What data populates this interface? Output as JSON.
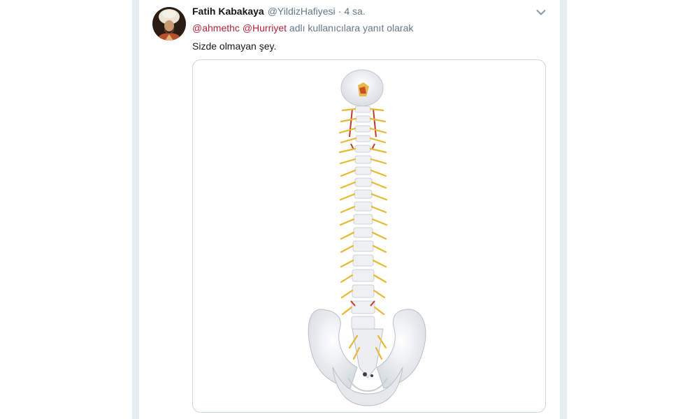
{
  "tweet": {
    "display_name": "Fatih Kabakaya",
    "handle": "@YildizHafiyesi",
    "separator": "·",
    "timestamp": "4 sa.",
    "reply_context": {
      "mentions": [
        "@ahmethc",
        "@Hurriyet"
      ],
      "suffix": "adlı kullanıcılara yanıt olarak"
    },
    "text": "Sizde olmayan şey.",
    "avatar_icon": "portrait-avatar",
    "menu_icon": "chevron-down-icon",
    "media_subject": "spine-model"
  },
  "colors": {
    "page_background": "#ffffff",
    "timeline_background": "#e6ecf0",
    "mention": "#b0243b",
    "secondary_text": "#657786",
    "primary_text": "#14171a"
  }
}
